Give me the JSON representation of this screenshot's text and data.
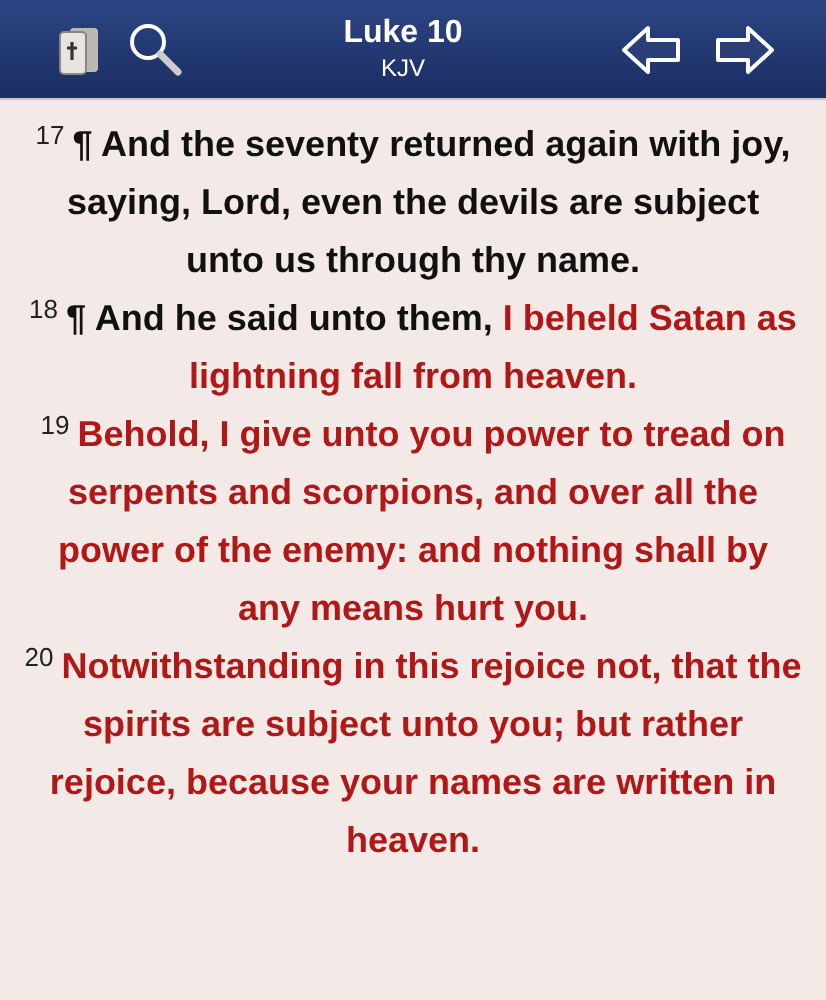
{
  "header": {
    "title": "Luke 10",
    "subtitle": "KJV"
  },
  "verses": [
    {
      "number": "17",
      "segments": [
        {
          "text": "¶ And the seventy returned again with joy, saying, Lord, even the devils are subject unto us through thy name.",
          "red": false
        }
      ]
    },
    {
      "number": "18",
      "segments": [
        {
          "text": "¶ And he said unto them, ",
          "red": false
        },
        {
          "text": "I beheld Satan as lightning fall from heaven.",
          "red": true
        }
      ]
    },
    {
      "number": "19",
      "segments": [
        {
          "text": "Behold, I give unto you power to tread on serpents and scorpions, and over all the power of the enemy: and nothing shall by any means hurt you.",
          "red": true
        }
      ]
    },
    {
      "number": "20",
      "segments": [
        {
          "text": "Notwithstanding in this rejoice not, that the spirits are subject unto you; but rather rejoice, because your names are written in heaven.",
          "red": true
        }
      ]
    }
  ]
}
